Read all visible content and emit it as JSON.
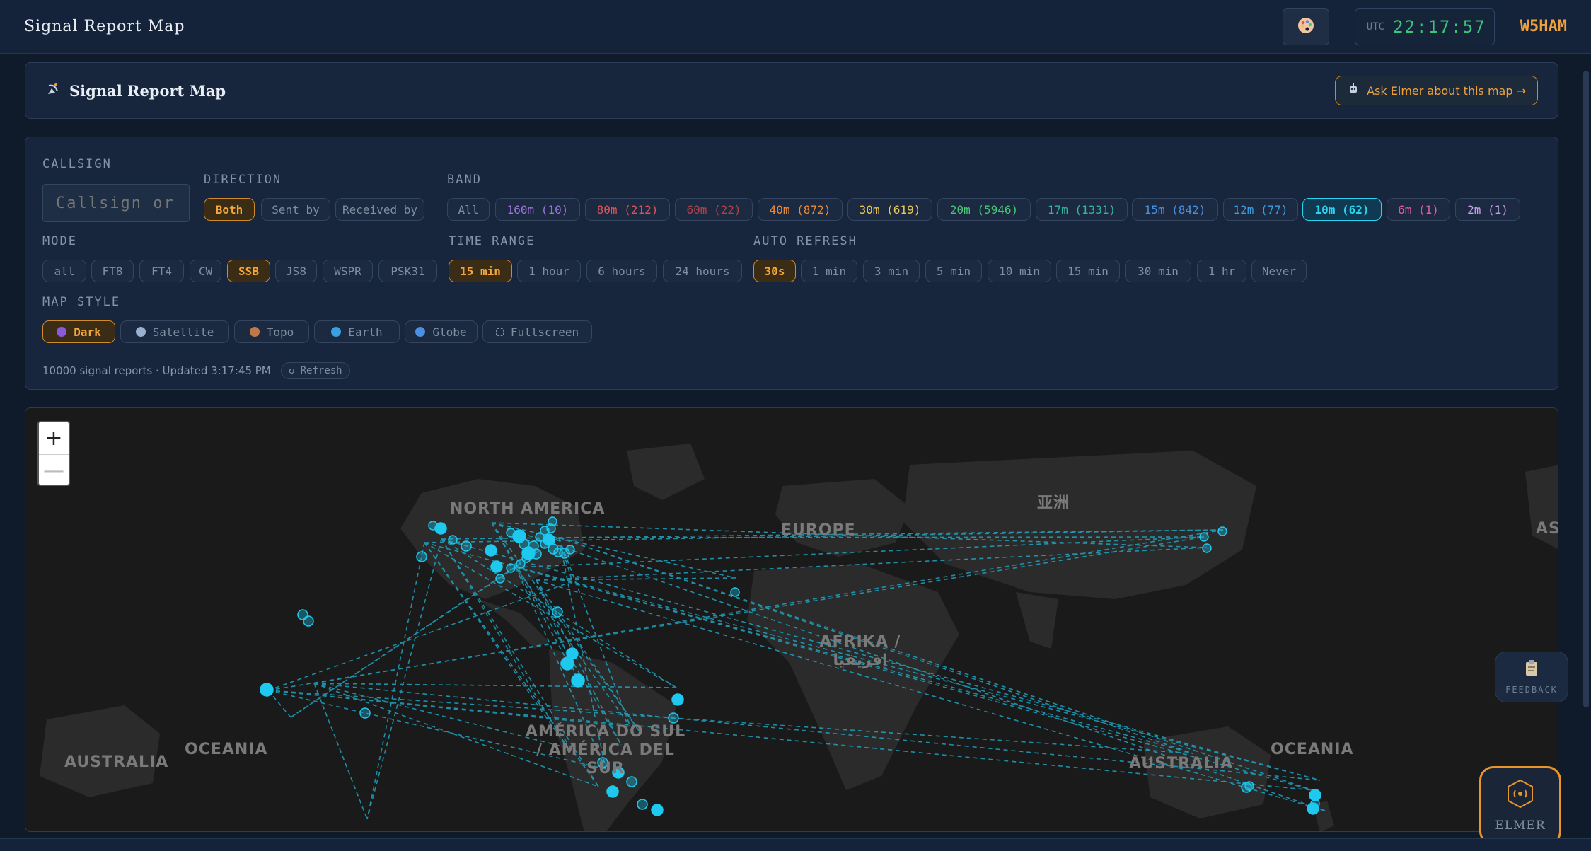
{
  "app": {
    "title": "Signal Report Map",
    "utc_label": "UTC",
    "time": "22:17:57",
    "callsign": "W5HAM"
  },
  "header": {
    "title": "Signal Report Map",
    "ask_button": "Ask Elmer about this map →"
  },
  "filters": {
    "callsign": {
      "label": "CALLSIGN",
      "placeholder": "Callsign or grid"
    },
    "direction": {
      "label": "DIRECTION",
      "options": [
        "Both",
        "Sent by",
        "Received by"
      ],
      "selected": "Both"
    },
    "band": {
      "label": "BAND",
      "options": [
        {
          "label": "All",
          "color": "#7f8ea3"
        },
        {
          "label": "160m (10)",
          "color": "#9b73d8"
        },
        {
          "label": "80m (212)",
          "color": "#e0525a"
        },
        {
          "label": "60m (22)",
          "color": "#b2414a"
        },
        {
          "label": "40m (872)",
          "color": "#e98a3c"
        },
        {
          "label": "30m (619)",
          "color": "#e8c85a"
        },
        {
          "label": "20m (5946)",
          "color": "#46c878"
        },
        {
          "label": "17m (1331)",
          "color": "#34b4a0"
        },
        {
          "label": "15m (842)",
          "color": "#4a8fe0"
        },
        {
          "label": "12m (77)",
          "color": "#3c9fe0"
        },
        {
          "label": "10m (62)",
          "color": "#2ad4f0"
        },
        {
          "label": "6m (1)",
          "color": "#e05aa8"
        },
        {
          "label": "2m (1)",
          "color": "#c9a0ee"
        }
      ],
      "selected": "10m (62)"
    },
    "mode": {
      "label": "MODE",
      "options": [
        "all",
        "FT8",
        "FT4",
        "CW",
        "SSB",
        "JS8",
        "WSPR",
        "PSK31"
      ],
      "selected": "SSB"
    },
    "time_range": {
      "label": "TIME RANGE",
      "options": [
        "15 min",
        "1 hour",
        "6 hours",
        "24 hours"
      ],
      "selected": "15 min"
    },
    "auto_refresh": {
      "label": "AUTO REFRESH",
      "options": [
        "30s",
        "1 min",
        "3 min",
        "5 min",
        "10 min",
        "15 min",
        "30 min",
        "1 hr",
        "Never"
      ],
      "selected": "30s"
    },
    "map_style": {
      "label": "MAP STYLE",
      "options": [
        {
          "label": "Dark",
          "icon": "moon-icon"
        },
        {
          "label": "Satellite",
          "icon": "satellite-icon"
        },
        {
          "label": "Topo",
          "icon": "mountain-icon"
        },
        {
          "label": "Earth",
          "icon": "earth-icon"
        },
        {
          "label": "Globe",
          "icon": "globe-icon"
        },
        {
          "label": "Fullscreen",
          "icon": "fullscreen-icon"
        }
      ],
      "selected": "Dark"
    },
    "status": "10000 signal reports · Updated 3:17:45 PM",
    "refresh_button": "↻ Refresh"
  },
  "map": {
    "zoom_in": "+",
    "zoom_out": "—",
    "labels": [
      "NORTH AMERICA",
      "EUROPE",
      "亚洲",
      "AFRIKA / إفريقيا",
      "AMÉRICA DO SUL / AMÉRICA DEL SUR",
      "AUSTRALIA",
      "OCEANIA",
      "AUSTRALIA",
      "OCEANIA",
      "AS"
    ],
    "accent": "#1ec8ee"
  },
  "feedback": {
    "label": "FEEDBACK"
  },
  "elmer": {
    "label": "ELMER"
  }
}
